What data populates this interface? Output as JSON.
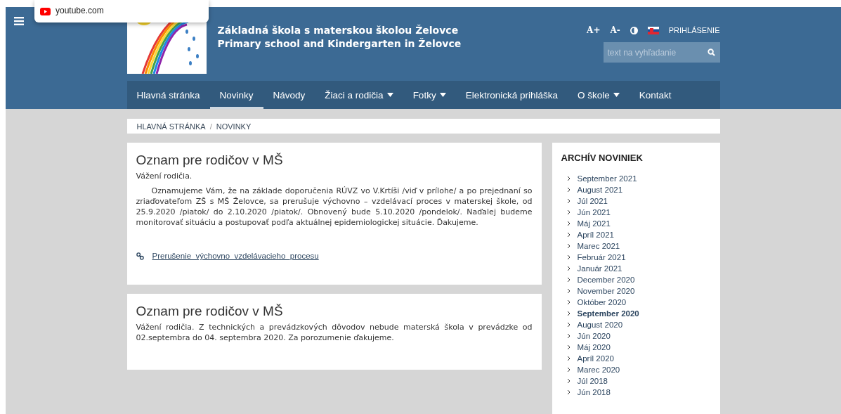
{
  "popup": {
    "site": "youtube.com"
  },
  "header": {
    "title_lines": [
      "Základná škola s materskou školou Želovce",
      "Primary school and Kindergarten in Želovce"
    ],
    "tools": [
      {
        "kind": "text",
        "label": "A+"
      },
      {
        "kind": "text",
        "label": "A-"
      },
      {
        "kind": "contrast"
      },
      {
        "kind": "flag"
      },
      {
        "kind": "login",
        "label": "PRIHLÁSENIE"
      }
    ],
    "search": {
      "placeholder": "text na vyhľadanie"
    }
  },
  "nav": [
    {
      "label": "Hlavná stránka",
      "selected": false,
      "dropdown": false
    },
    {
      "label": "Novinky",
      "selected": true,
      "dropdown": false
    },
    {
      "label": "Návody",
      "selected": false,
      "dropdown": false
    },
    {
      "label": "Žiaci a rodičia",
      "selected": false,
      "dropdown": true
    },
    {
      "label": "Fotky",
      "selected": false,
      "dropdown": true
    },
    {
      "label": "Elektronická prihláška",
      "selected": false,
      "dropdown": false
    },
    {
      "label": "O škole",
      "selected": false,
      "dropdown": true
    },
    {
      "label": "Kontakt",
      "selected": false,
      "dropdown": false
    }
  ],
  "breadcrumb": {
    "separator": "/",
    "items": [
      "HLAVNÁ STRÁNKA",
      "NOVINKY"
    ]
  },
  "posts": [
    {
      "title": "Oznam pre rodičov v MŠ",
      "paragraphs": [
        {
          "indent": false,
          "text": "Vážení rodičia."
        },
        {
          "indent": true,
          "text": "Oznamujeme Vám, že na základe doporučenia RÚVZ vo V.Krtíši /viď v prílohe/ a po prejednaní so zriaďovateľom ZŠ s MŠ Želovce, sa prerušuje výchovno – vzdelávací proces v materskej škole, od 25.9.2020 /piatok/ do 2.10.2020 /piatok/. Obnovený bude 5.10.2020 /pondelok/. Naďalej budeme monitorovať situáciu a postupovať podľa aktuálnej epidemiologickej situácie. Ďakujeme."
        }
      ],
      "attachment": "Prerušenie_výchovno_vzdelávacieho_procesu"
    },
    {
      "title": "Oznam pre rodičov v MŠ",
      "paragraphs": [
        {
          "indent": false,
          "text": "Vážení rodičia. Z technických a prevádzkových dôvodov nebude materská škola v prevádzke od 02.septembra do 04. septembra 2020. Za porozumenie ďakujeme."
        }
      ]
    }
  ],
  "archive": {
    "title": "ARCHÍV NOVINIEK",
    "items": [
      {
        "label": "September 2021",
        "selected": false
      },
      {
        "label": "August 2021",
        "selected": false
      },
      {
        "label": "Júl 2021",
        "selected": false
      },
      {
        "label": "Jún 2021",
        "selected": false
      },
      {
        "label": "Máj 2021",
        "selected": false
      },
      {
        "label": "Apríl 2021",
        "selected": false
      },
      {
        "label": "Marec 2021",
        "selected": false
      },
      {
        "label": "Február 2021",
        "selected": false
      },
      {
        "label": "Január 2021",
        "selected": false
      },
      {
        "label": "December 2020",
        "selected": false
      },
      {
        "label": "November 2020",
        "selected": false
      },
      {
        "label": "Október 2020",
        "selected": false
      },
      {
        "label": "September 2020",
        "selected": true
      },
      {
        "label": "August 2020",
        "selected": false
      },
      {
        "label": "Jún 2020",
        "selected": false
      },
      {
        "label": "Máj 2020",
        "selected": false
      },
      {
        "label": "Apríl 2020",
        "selected": false
      },
      {
        "label": "Marec 2020",
        "selected": false
      },
      {
        "label": "Júl 2018",
        "selected": false
      },
      {
        "label": "Jún 2018",
        "selected": false
      }
    ]
  }
}
